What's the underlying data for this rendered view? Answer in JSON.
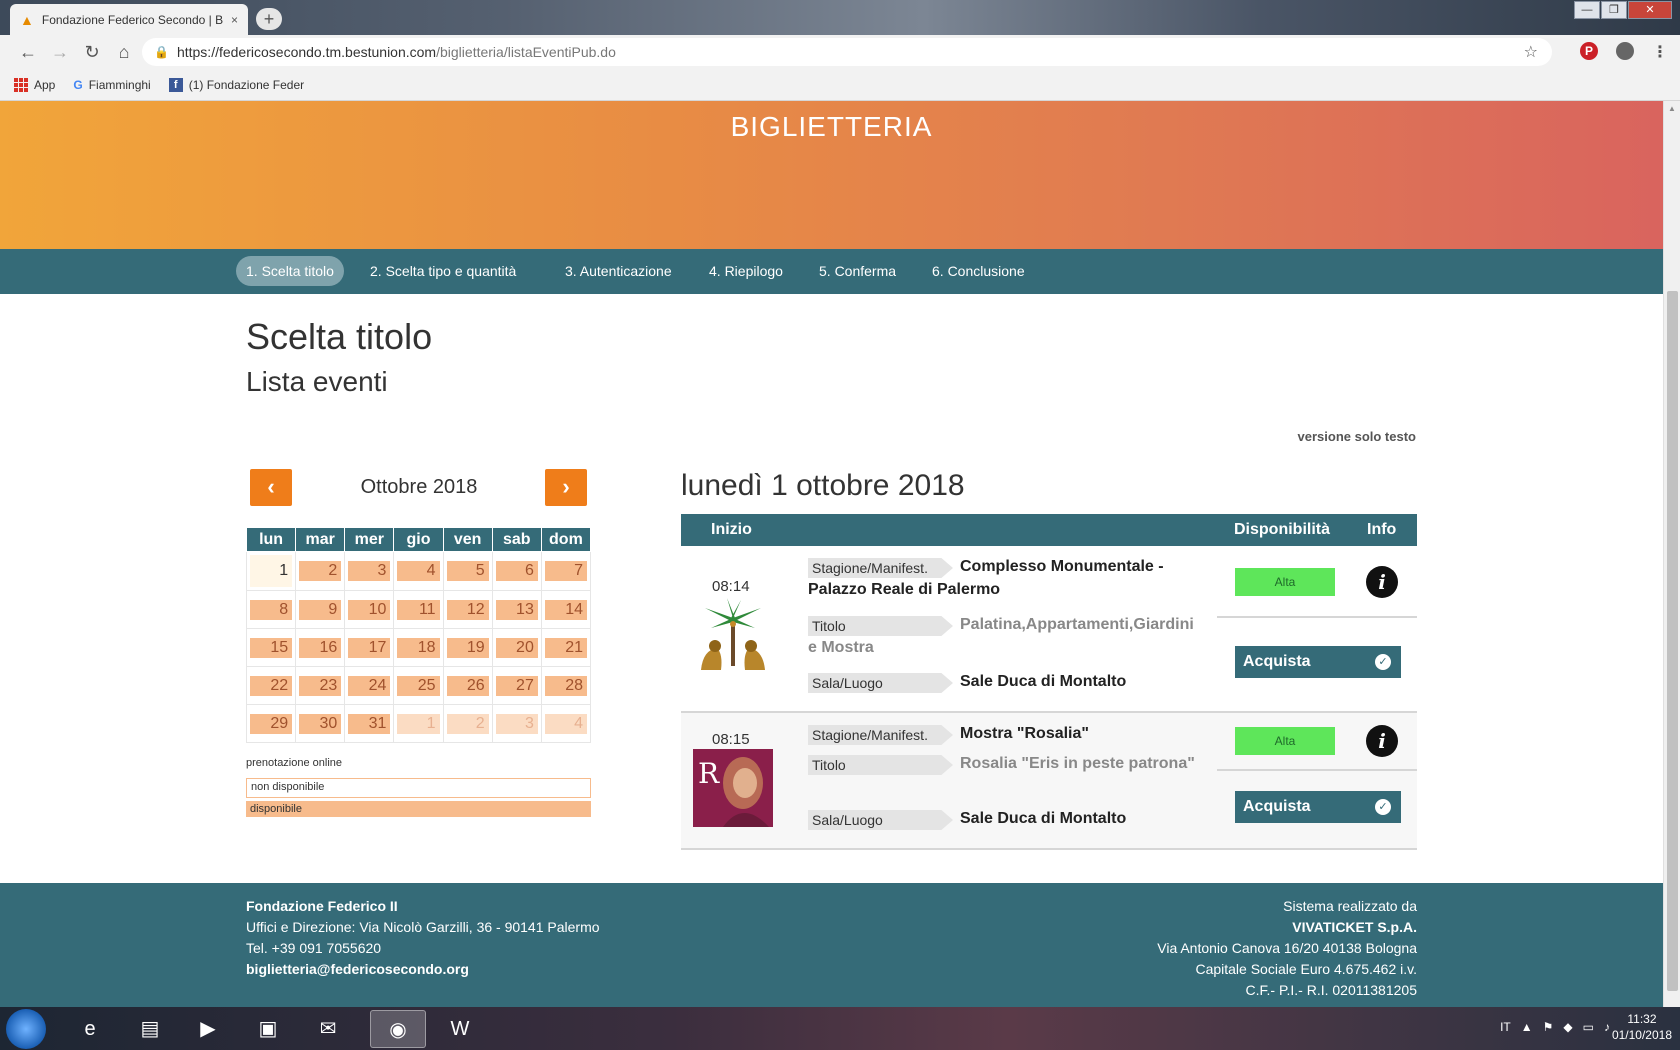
{
  "browser": {
    "tab_title": "Fondazione Federico Secondo | B",
    "tab_close": "×",
    "new_tab": "+",
    "url_host": "https://federicosecondo.tm.bestunion.com",
    "url_path": "/biglietteria/listaEventiPub.do",
    "bookmarks": [
      "App",
      "Fiamminghi",
      "(1) Fondazione Feder"
    ]
  },
  "header": {
    "title": "BIGLIETTERIA"
  },
  "steps": [
    "1. Scelta titolo",
    "2. Scelta tipo e quantità",
    "3. Autenticazione",
    "4. Riepilogo",
    "5. Conferma",
    "6. Conclusione"
  ],
  "page": {
    "title": "Scelta titolo",
    "subtitle": "Lista eventi",
    "text_version": "versione solo testo"
  },
  "calendar": {
    "month": "Ottobre 2018",
    "weekdays": [
      "lun",
      "mar",
      "mer",
      "gio",
      "ven",
      "sab",
      "dom"
    ],
    "rows": [
      [
        "1",
        "2",
        "3",
        "4",
        "5",
        "6",
        "7"
      ],
      [
        "8",
        "9",
        "10",
        "11",
        "12",
        "13",
        "14"
      ],
      [
        "15",
        "16",
        "17",
        "18",
        "19",
        "20",
        "21"
      ],
      [
        "22",
        "23",
        "24",
        "25",
        "26",
        "27",
        "28"
      ],
      [
        "29",
        "30",
        "31",
        "1",
        "2",
        "3",
        "4"
      ]
    ],
    "legend_title": "prenotazione online",
    "legend_unavailable": "non disponibile",
    "legend_available": "disponibile"
  },
  "events": {
    "date": "lunedì 1 ottobre 2018",
    "col_start": "Inizio",
    "col_availability": "Disponibilità",
    "col_info": "Info",
    "label_season": "Stagione/Manifest.",
    "label_title": "Titolo",
    "label_venue": "Sala/Luogo",
    "buy_label": "Acquista",
    "items": [
      {
        "time": "08:14",
        "season": "Complesso Monumentale - Palazzo Reale di Palermo",
        "title": "Palatina,Appartamenti,Giardini e Mostra",
        "venue": "Sale Duca di Montalto",
        "availability": "Alta"
      },
      {
        "time": "08:15",
        "season": "Mostra \"Rosalia\"",
        "title": "Rosalia \"Eris in peste patrona\"",
        "venue": "Sale Duca di Montalto",
        "availability": "Alta"
      }
    ]
  },
  "footer": {
    "left": [
      "Fondazione Federico II",
      "Uffici e Direzione: Via Nicolò Garzilli, 36 - 90141 Palermo",
      "Tel. +39 091 7055620",
      "biglietteria@federicosecondo.org"
    ],
    "right": [
      "Sistema realizzato da",
      "VIVATICKET S.p.A.",
      "Via Antonio Canova 16/20 40138 Bologna",
      "Capitale Sociale Euro 4.675.462 i.v.",
      "C.F.- P.I.- R.I. 02011381205"
    ]
  },
  "taskbar": {
    "lang": "IT",
    "time": "11:32",
    "date": "01/10/2018"
  },
  "colors": {
    "teal": "#356b78",
    "orange": "#ef7d1a",
    "available": "#f7bb8c",
    "high_availability": "#5ee65a"
  }
}
